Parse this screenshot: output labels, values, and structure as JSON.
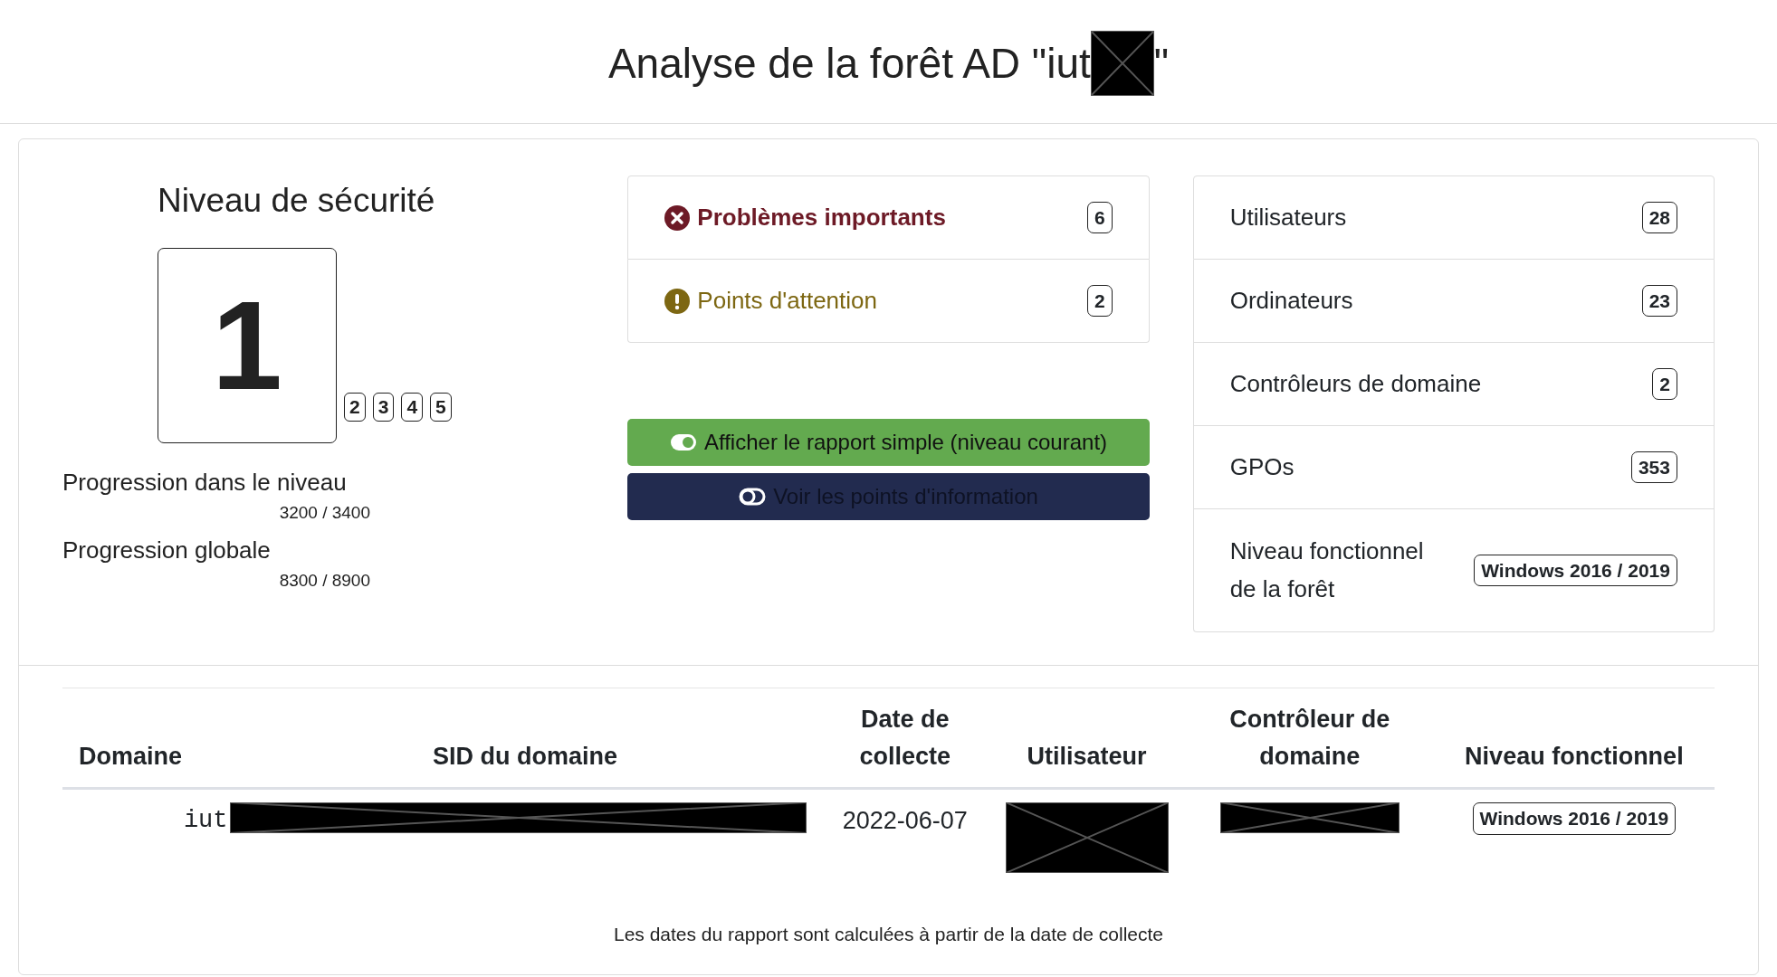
{
  "title": {
    "before": "Analyse de la forêt AD \"iut",
    "redacted": true,
    "after": "\""
  },
  "security": {
    "heading": "Niveau de sécurité",
    "levels": [
      {
        "label": "1",
        "selected": true
      },
      {
        "label": "2",
        "selected": false
      },
      {
        "label": "3",
        "selected": false
      },
      {
        "label": "4",
        "selected": false
      },
      {
        "label": "5",
        "selected": false
      }
    ],
    "progress": [
      {
        "label": "Progression dans le niveau",
        "value": "3200 / 3400"
      },
      {
        "label": "Progression globale",
        "value": "8300 / 8900"
      }
    ]
  },
  "issues": [
    {
      "kind": "critical",
      "label": "Problèmes importants",
      "count": "6"
    },
    {
      "kind": "warning",
      "label": "Points d'attention",
      "count": "2"
    }
  ],
  "toggles": [
    {
      "kind": "success",
      "label": "Afficher le rapport simple (niveau courant)",
      "on": true
    },
    {
      "kind": "dark",
      "label": "Voir les points d'information",
      "on": false
    }
  ],
  "stats": [
    {
      "label": "Utilisateurs",
      "value": "28"
    },
    {
      "label": "Ordinateurs",
      "value": "23"
    },
    {
      "label": "Contrôleurs de domaine",
      "value": "2"
    },
    {
      "label": "GPOs",
      "value": "353"
    },
    {
      "label": "Niveau fonctionnel de la forêt",
      "value": "Windows 2016 / 2019"
    }
  ],
  "table": {
    "columns": [
      "Domaine",
      "SID du domaine",
      "Date de collecte",
      "Utilisateur",
      "Contrôleur de domaine",
      "Niveau fonctionnel"
    ],
    "rows": [
      [
        {
          "kind": "mono",
          "text": "iut"
        },
        {
          "kind": "redacted"
        },
        {
          "kind": "text",
          "text": "2022-06-07"
        },
        {
          "kind": "redacted_block"
        },
        {
          "kind": "redacted"
        },
        {
          "kind": "badge",
          "text": "Windows 2016 / 2019"
        }
      ]
    ]
  },
  "footnote": "Les dates du rapport sont calculées à partir de la date de collecte"
}
